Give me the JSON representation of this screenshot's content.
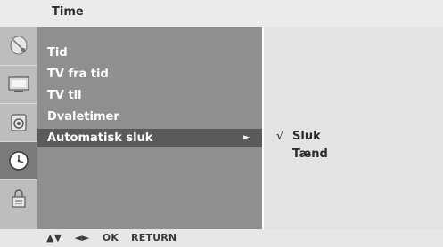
{
  "title": "Time",
  "menu": {
    "items": [
      {
        "label": "Tid"
      },
      {
        "label": "TV fra tid"
      },
      {
        "label": "TV til"
      },
      {
        "label": "Dvaletimer"
      },
      {
        "label": "Automatisk sluk",
        "selected": true
      }
    ],
    "selected_arrow": "►"
  },
  "submenu": {
    "check_mark": "√",
    "options": [
      {
        "label": "Sluk",
        "checked": true
      },
      {
        "label": "Tænd",
        "checked": false
      }
    ]
  },
  "side_icons": [
    {
      "name": "satellite-dish-icon",
      "active": false
    },
    {
      "name": "tv-picture-icon",
      "active": false
    },
    {
      "name": "audio-speaker-icon",
      "active": false
    },
    {
      "name": "clock-icon",
      "active": true
    },
    {
      "name": "options-lock-icon",
      "active": false
    }
  ],
  "footer": {
    "updown": "▲▼",
    "leftright": "◄►",
    "ok": "OK",
    "return": "RETURN"
  },
  "colors": {
    "title_bar": "#ebebeb",
    "icon_column": "#bdbdbd",
    "icon_active": "#7a7a7a",
    "menu_bg": "#8f8f8f",
    "menu_selected": "#5a5a5a",
    "submenu_bg": "#e3e3e3",
    "footer_bg": "#e7e7e7"
  }
}
